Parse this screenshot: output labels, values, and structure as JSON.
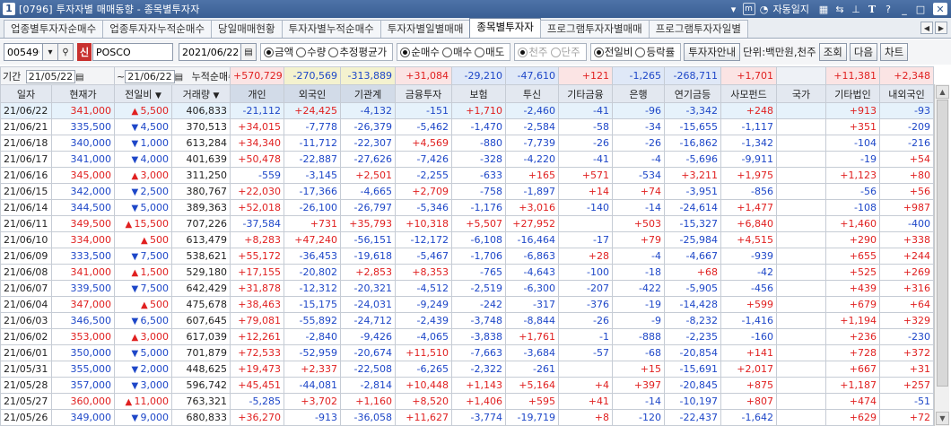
{
  "window": {
    "screen_no": "1",
    "code": "[0796]",
    "title": "투자자별 매매동향 - 종목별투자자",
    "auto_log": "자동일지"
  },
  "tabs": [
    {
      "label": "업종별투자자순매수",
      "active": false
    },
    {
      "label": "업종투자자누적순매수",
      "active": false
    },
    {
      "label": "당일매매현황",
      "active": false
    },
    {
      "label": "투자자별누적순매수",
      "active": false
    },
    {
      "label": "투자자별일별매매",
      "active": false
    },
    {
      "label": "종목별투자자",
      "active": true
    },
    {
      "label": "프로그램투자자별매매",
      "active": false
    },
    {
      "label": "프로그램투자자일별",
      "active": false
    }
  ],
  "toolbar": {
    "stock_code": "005490",
    "shin_label": "신",
    "stock_name": "POSCO",
    "date": "2021/06/22",
    "radio_group1": [
      {
        "label": "금액",
        "on": true
      },
      {
        "label": "수량",
        "on": false
      },
      {
        "label": "추정평균가",
        "on": false
      }
    ],
    "radio_group2": [
      {
        "label": "순매수",
        "on": true
      },
      {
        "label": "매수",
        "on": false
      },
      {
        "label": "매도",
        "on": false
      }
    ],
    "radio_group3": [
      {
        "label": "천주",
        "on": true,
        "disabled": true
      },
      {
        "label": "단주",
        "on": false,
        "disabled": true
      }
    ],
    "radio_group4": [
      {
        "label": "전일비",
        "on": true
      },
      {
        "label": "등락률",
        "on": false
      }
    ],
    "guide_button": "투자자안내",
    "unit_label": "단위:백만원,천주",
    "query_button": "조회",
    "next_button": "다음",
    "chart_button": "차트"
  },
  "filter": {
    "period_label": "기간",
    "date_from": "21/05/22",
    "date_sep": "~",
    "date_to": "21/06/22",
    "cum_label": "누적순매수",
    "cum_values": [
      "+570,729",
      "-270,569",
      "-313,889",
      "+31,084",
      "-29,210",
      "-47,610",
      "+121",
      "-1,265",
      "-268,711",
      "+1,701",
      "",
      "+11,381",
      "+2,348"
    ]
  },
  "columns": [
    "일자",
    "현재가",
    "전일비",
    "거래량",
    "개인",
    "외국인",
    "기관계",
    "금융투자",
    "보험",
    "투신",
    "기타금융",
    "은행",
    "연기금등",
    "사모펀드",
    "국가",
    "기타법인",
    "내외국인"
  ],
  "rows": [
    [
      "21/06/22",
      "341,000",
      "up",
      "5,500",
      "406,833",
      "-21,112",
      "+24,425",
      "-4,132",
      "-151",
      "+1,710",
      "-2,460",
      "-41",
      "-96",
      "-3,342",
      "+248",
      "",
      "+913",
      "-93"
    ],
    [
      "21/06/21",
      "335,500",
      "down",
      "4,500",
      "370,513",
      "+34,015",
      "-7,778",
      "-26,379",
      "-5,462",
      "-1,470",
      "-2,584",
      "-58",
      "-34",
      "-15,655",
      "-1,117",
      "",
      "+351",
      "-209"
    ],
    [
      "21/06/18",
      "340,000",
      "down",
      "1,000",
      "613,284",
      "+34,340",
      "-11,712",
      "-22,307",
      "+4,569",
      "-880",
      "-7,739",
      "-26",
      "-26",
      "-16,862",
      "-1,342",
      "",
      "-104",
      "-216"
    ],
    [
      "21/06/17",
      "341,000",
      "down",
      "4,000",
      "401,639",
      "+50,478",
      "-22,887",
      "-27,626",
      "-7,426",
      "-328",
      "-4,220",
      "-41",
      "-4",
      "-5,696",
      "-9,911",
      "",
      "-19",
      "+54"
    ],
    [
      "21/06/16",
      "345,000",
      "up",
      "3,000",
      "311,250",
      "-559",
      "-3,145",
      "+2,501",
      "-2,255",
      "-633",
      "+165",
      "+571",
      "-534",
      "+3,211",
      "+1,975",
      "",
      "+1,123",
      "+80"
    ],
    [
      "21/06/15",
      "342,000",
      "down",
      "2,500",
      "380,767",
      "+22,030",
      "-17,366",
      "-4,665",
      "+2,709",
      "-758",
      "-1,897",
      "+14",
      "+74",
      "-3,951",
      "-856",
      "",
      "-56",
      "+56"
    ],
    [
      "21/06/14",
      "344,500",
      "down",
      "5,000",
      "389,363",
      "+52,018",
      "-26,100",
      "-26,797",
      "-5,346",
      "-1,176",
      "+3,016",
      "-140",
      "-14",
      "-24,614",
      "+1,477",
      "",
      "-108",
      "+987"
    ],
    [
      "21/06/11",
      "349,500",
      "up",
      "15,500",
      "707,226",
      "-37,584",
      "+731",
      "+35,793",
      "+10,318",
      "+5,507",
      "+27,952",
      "",
      "+503",
      "-15,327",
      "+6,840",
      "",
      "+1,460",
      "-400"
    ],
    [
      "21/06/10",
      "334,000",
      "up",
      "500",
      "613,479",
      "+8,283",
      "+47,240",
      "-56,151",
      "-12,172",
      "-6,108",
      "-16,464",
      "-17",
      "+79",
      "-25,984",
      "+4,515",
      "",
      "+290",
      "+338"
    ],
    [
      "21/06/09",
      "333,500",
      "down",
      "7,500",
      "538,621",
      "+55,172",
      "-36,453",
      "-19,618",
      "-5,467",
      "-1,706",
      "-6,863",
      "+28",
      "-4",
      "-4,667",
      "-939",
      "",
      "+655",
      "+244"
    ],
    [
      "21/06/08",
      "341,000",
      "up",
      "1,500",
      "529,180",
      "+17,155",
      "-20,802",
      "+2,853",
      "+8,353",
      "-765",
      "-4,643",
      "-100",
      "-18",
      "+68",
      "-42",
      "",
      "+525",
      "+269"
    ],
    [
      "21/06/07",
      "339,500",
      "down",
      "7,500",
      "642,429",
      "+31,878",
      "-12,312",
      "-20,321",
      "-4,512",
      "-2,519",
      "-6,300",
      "-207",
      "-422",
      "-5,905",
      "-456",
      "",
      "+439",
      "+316"
    ],
    [
      "21/06/04",
      "347,000",
      "up",
      "500",
      "475,678",
      "+38,463",
      "-15,175",
      "-24,031",
      "-9,249",
      "-242",
      "-317",
      "-376",
      "-19",
      "-14,428",
      "+599",
      "",
      "+679",
      "+64"
    ],
    [
      "21/06/03",
      "346,500",
      "down",
      "6,500",
      "607,645",
      "+79,081",
      "-55,892",
      "-24,712",
      "-2,439",
      "-3,748",
      "-8,844",
      "-26",
      "-9",
      "-8,232",
      "-1,416",
      "",
      "+1,194",
      "+329"
    ],
    [
      "21/06/02",
      "353,000",
      "up",
      "3,000",
      "617,039",
      "+12,261",
      "-2,840",
      "-9,426",
      "-4,065",
      "-3,838",
      "+1,761",
      "-1",
      "-888",
      "-2,235",
      "-160",
      "",
      "+236",
      "-230"
    ],
    [
      "21/06/01",
      "350,000",
      "down",
      "5,000",
      "701,879",
      "+72,533",
      "-52,959",
      "-20,674",
      "+11,510",
      "-7,663",
      "-3,684",
      "-57",
      "-68",
      "-20,854",
      "+141",
      "",
      "+728",
      "+372"
    ],
    [
      "21/05/31",
      "355,000",
      "down",
      "2,000",
      "448,625",
      "+19,473",
      "+2,337",
      "-22,508",
      "-6,265",
      "-2,322",
      "-261",
      "",
      "+15",
      "-15,691",
      "+2,017",
      "",
      "+667",
      "+31"
    ],
    [
      "21/05/28",
      "357,000",
      "down",
      "3,000",
      "596,742",
      "+45,451",
      "-44,081",
      "-2,814",
      "+10,448",
      "+1,143",
      "+5,164",
      "+4",
      "+397",
      "-20,845",
      "+875",
      "",
      "+1,187",
      "+257"
    ],
    [
      "21/05/27",
      "360,000",
      "up",
      "11,000",
      "763,321",
      "-5,285",
      "+3,702",
      "+1,160",
      "+8,520",
      "+1,406",
      "+595",
      "+41",
      "-14",
      "-10,197",
      "+807",
      "",
      "+474",
      "-51"
    ],
    [
      "21/05/26",
      "349,000",
      "down",
      "9,000",
      "680,833",
      "+36,270",
      "-913",
      "-36,058",
      "+11,627",
      "-3,774",
      "-19,719",
      "+8",
      "-120",
      "-22,437",
      "-1,642",
      "",
      "+629",
      "+72"
    ]
  ],
  "colors": {
    "up": "#e02020",
    "down": "#1e47c8",
    "title_bar": "#3a5f93"
  }
}
